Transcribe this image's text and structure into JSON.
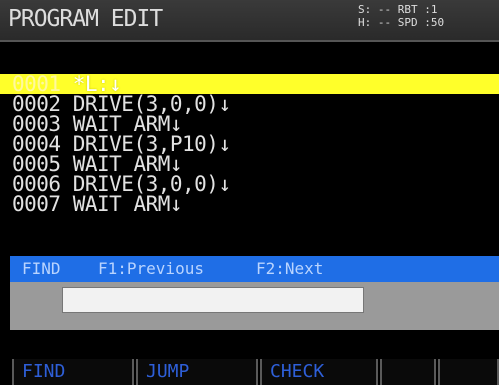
{
  "header": {
    "title": "PROGRAM EDIT",
    "status_line1": "S: -- RBT :1",
    "status_line2": "H: -- SPD :50"
  },
  "program": {
    "lines": [
      {
        "num": "0001",
        "text": "*L:↓"
      },
      {
        "num": "0002",
        "text": "DRIVE(3,0,0)↓"
      },
      {
        "num": "0003",
        "text": "WAIT ARM↓"
      },
      {
        "num": "0004",
        "text": "DRIVE(3,P10)↓"
      },
      {
        "num": "0005",
        "text": "WAIT ARM↓"
      },
      {
        "num": "0006",
        "text": "DRIVE(3,0,0)↓"
      },
      {
        "num": "0007",
        "text": "WAIT ARM↓"
      }
    ]
  },
  "find_dialog": {
    "title": "FIND",
    "previous": "F1:Previous",
    "next": "F2:Next",
    "input_value": ""
  },
  "function_keys": {
    "marker": "A",
    "keys": [
      "FIND",
      "JUMP",
      "CHECK",
      "",
      ""
    ]
  },
  "colors": {
    "highlight": "#ffff2a",
    "dialog_header": "#1f6ee6",
    "fkey_text": "#2e5fd8"
  }
}
